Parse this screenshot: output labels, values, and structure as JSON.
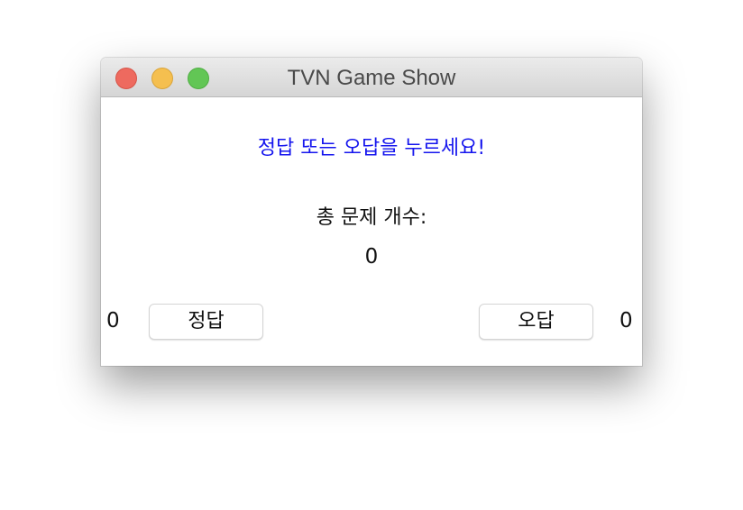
{
  "window": {
    "title": "TVN Game Show"
  },
  "content": {
    "instruction": "정답 또는 오답을 누르세요!",
    "total_label": "총 문제 개수:",
    "total_value": "0",
    "correct_score": "0",
    "wrong_score": "0",
    "correct_button": "정답",
    "wrong_button": "오답"
  },
  "colors": {
    "instruction_text": "#1515ee",
    "close": "#ee6a5f",
    "minimize": "#f5bf4f",
    "zoom": "#62c655"
  }
}
